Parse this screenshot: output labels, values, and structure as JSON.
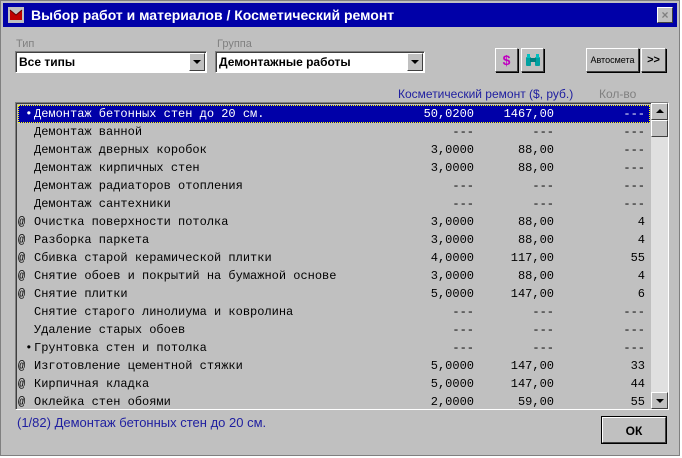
{
  "window": {
    "title": "Выбор работ и материалов  /  Косметический ремонт",
    "close_label": "×"
  },
  "filters": {
    "type_label": "Тип",
    "type_value": "Все типы",
    "group_label": "Группа",
    "group_value": "Демонтажные работы"
  },
  "toolbar": {
    "dollar_label": "$",
    "search_icon": "binoculars-icon",
    "autosmeta_label": "Автосмета",
    "next_label": ">>"
  },
  "columns": {
    "repair_header": "Косметический ремонт ($, руб.)",
    "qty_header": "Кол-во"
  },
  "rows": [
    {
      "mark": " •",
      "name": "Демонтаж бетонных стен до 20 см.",
      "price": "50,0200",
      "cost": "1467,00",
      "qty": "---"
    },
    {
      "mark": "",
      "name": "Демонтаж ванной",
      "price": "---",
      "cost": "---",
      "qty": "---"
    },
    {
      "mark": "",
      "name": "Демонтаж дверных коробок",
      "price": "3,0000",
      "cost": "88,00",
      "qty": "---"
    },
    {
      "mark": "",
      "name": "Демонтаж кирпичных стен",
      "price": "3,0000",
      "cost": "88,00",
      "qty": "---"
    },
    {
      "mark": "",
      "name": "Демонтаж радиаторов отопления",
      "price": "---",
      "cost": "---",
      "qty": "---"
    },
    {
      "mark": "",
      "name": "Демонтаж сантехники",
      "price": "---",
      "cost": "---",
      "qty": "---"
    },
    {
      "mark": "@",
      "name": "Очистка поверхности потолка",
      "price": "3,0000",
      "cost": "88,00",
      "qty": "4"
    },
    {
      "mark": "@",
      "name": "Разборка паркета",
      "price": "3,0000",
      "cost": "88,00",
      "qty": "4"
    },
    {
      "mark": "@",
      "name": "Сбивка старой керамической плитки",
      "price": "4,0000",
      "cost": "117,00",
      "qty": "55"
    },
    {
      "mark": "@",
      "name": "Снятие обоев и покрытий на бумажной основе",
      "price": "3,0000",
      "cost": "88,00",
      "qty": "4"
    },
    {
      "mark": "@",
      "name": "Снятие плитки",
      "price": "5,0000",
      "cost": "147,00",
      "qty": "6"
    },
    {
      "mark": "",
      "name": "Снятие старого линолиума и ковролина",
      "price": "---",
      "cost": "---",
      "qty": "---"
    },
    {
      "mark": "",
      "name": "Удаление старых обоев",
      "price": "---",
      "cost": "---",
      "qty": "---"
    },
    {
      "mark": " •",
      "name": "Грунтовка стен и потолка",
      "price": "---",
      "cost": "---",
      "qty": "---"
    },
    {
      "mark": "@",
      "name": "Изготовление цементной стяжки",
      "price": "5,0000",
      "cost": "147,00",
      "qty": "33"
    },
    {
      "mark": "@",
      "name": "Кирпичная кладка",
      "price": "5,0000",
      "cost": "147,00",
      "qty": "44"
    },
    {
      "mark": "@",
      "name": "Оклейка стен обоями",
      "price": "2,0000",
      "cost": "59,00",
      "qty": "55"
    }
  ],
  "status": {
    "text": "(1/82)  Демонтаж бетонных стен до 20 см."
  },
  "ok_label": "ОК",
  "colors": {
    "title_bar": "#0000a8",
    "selection": "#0000a8",
    "header_text": "#2020a0",
    "dollar_text": "#c000c0",
    "search_icon": "#00a0a0"
  }
}
